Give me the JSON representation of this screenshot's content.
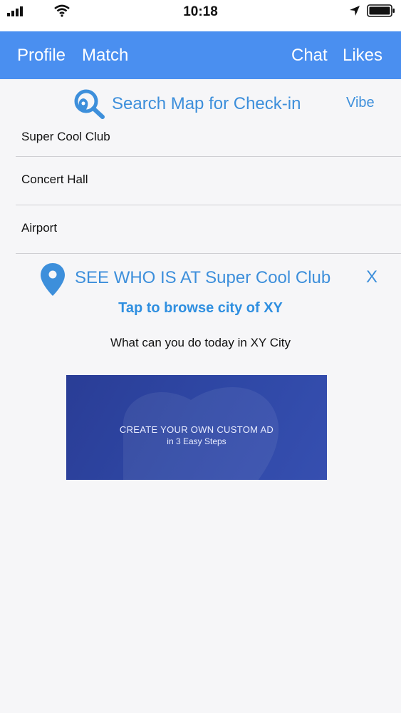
{
  "status_bar": {
    "time": "10:18",
    "icons": [
      "signal-icon",
      "wifi-icon",
      "location-arrow-icon",
      "battery-icon"
    ]
  },
  "nav": {
    "profile": "Profile",
    "match": "Match",
    "chat": "Chat",
    "likes": "Likes",
    "background_color": "#4a8ff0"
  },
  "search": {
    "label": "Search Map for Check-in",
    "vibe": "Vibe",
    "icon": "map-search-icon"
  },
  "locations": [
    {
      "label": "Super Cool Club"
    },
    {
      "label": "Concert Hall"
    },
    {
      "label": "Airport"
    }
  ],
  "see_who": {
    "text": "SEE WHO IS AT Super Cool Club",
    "close": "X",
    "icon": "map-pin-icon"
  },
  "browse": {
    "link": "Tap to browse city of XY",
    "subtitle": "What can you do today in XY City"
  },
  "ad": {
    "line1": "CREATE YOUR OWN CUSTOM AD",
    "line2": "in 3 Easy Steps"
  },
  "colors": {
    "accent": "#3d8fdb",
    "ad_background": "#2f48a6"
  }
}
